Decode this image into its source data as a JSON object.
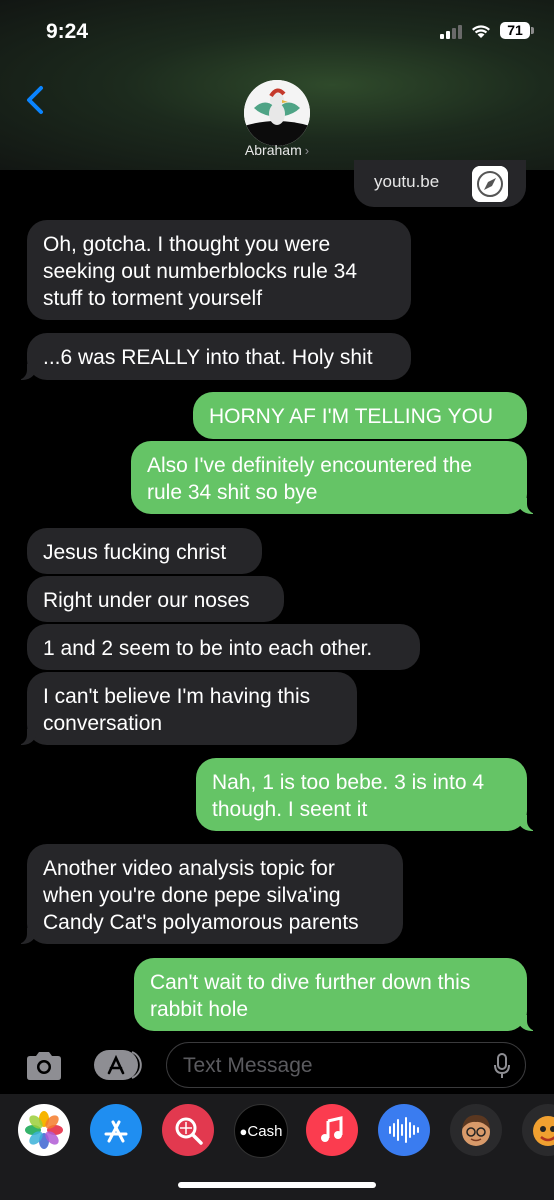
{
  "status": {
    "time": "9:24",
    "battery": "71"
  },
  "contact": {
    "name": "Abraham",
    "chevron": "›"
  },
  "link_preview": {
    "domain": "youtu.be",
    "icon": "compass-icon"
  },
  "messages": [
    {
      "from": "them",
      "text": "Oh, gotcha. I thought you were seeking out numberblocks rule 34 stuff to torment yourself"
    },
    {
      "from": "them",
      "text": "...6 was REALLY into that. Holy shit"
    },
    {
      "from": "me",
      "text": "HORNY AF I'M TELLING YOU"
    },
    {
      "from": "me",
      "text": "Also I've definitely encountered the rule 34 shit so bye"
    },
    {
      "from": "them",
      "text": "Jesus fucking christ"
    },
    {
      "from": "them",
      "text": "Right under our noses"
    },
    {
      "from": "them",
      "text": "1 and 2 seem to be into each other."
    },
    {
      "from": "them",
      "text": "I can't believe I'm having this conversation"
    },
    {
      "from": "me",
      "text": "Nah, 1 is too bebe. 3 is into 4 though. I seent it"
    },
    {
      "from": "them",
      "text": "Another video analysis topic for when you're done pepe silva'ing Candy Cat's polyamorous parents"
    },
    {
      "from": "me",
      "text": "Can't wait to dive further down this rabbit hole"
    }
  ],
  "input": {
    "placeholder": "Text Message"
  },
  "apps": [
    {
      "name": "photos-icon"
    },
    {
      "name": "app-store-icon"
    },
    {
      "name": "images-search-icon"
    },
    {
      "name": "cash-icon",
      "label": "Cash"
    },
    {
      "name": "music-icon"
    },
    {
      "name": "audio-message-icon"
    },
    {
      "name": "memoji-icon"
    },
    {
      "name": "animoji-icon"
    }
  ],
  "colors": {
    "sent_bubble": "#65c466",
    "received_bubble": "#262629",
    "accent": "#0a84ff"
  }
}
